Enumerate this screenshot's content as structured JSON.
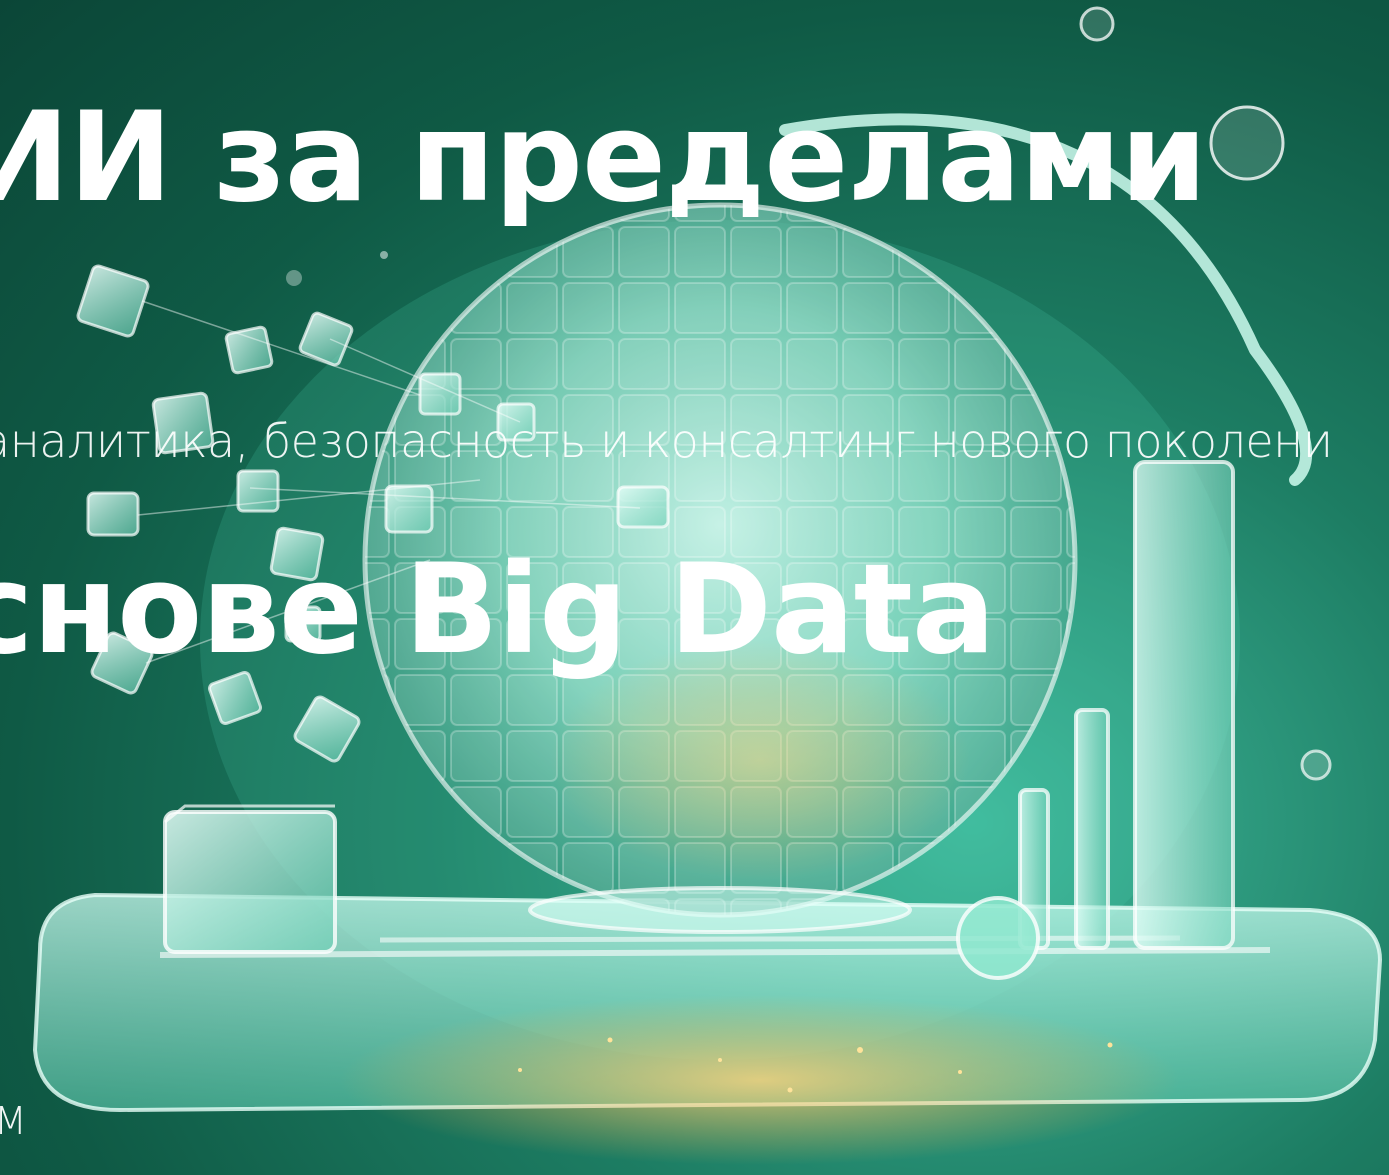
{
  "hero": {
    "headline_line1": "ИИ за пределами",
    "subtitle": "аналитика, безопасность и консалтинг нового поколени",
    "headline_line2": "снове Big Data",
    "footer_text": "М"
  },
  "colors": {
    "background_dark": "#0b4637",
    "background_mid": "#1d7d63",
    "glass_mint": "#bff3e6",
    "glow_amber": "#f7b14a",
    "text": "#ffffff"
  }
}
